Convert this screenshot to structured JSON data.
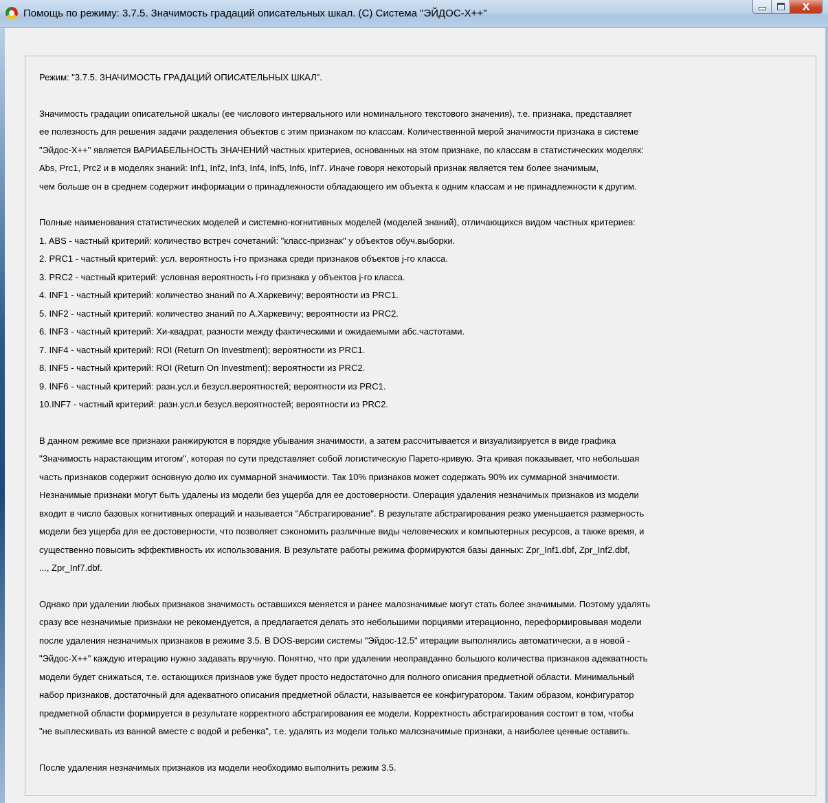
{
  "window": {
    "title": "Помощь по режиму: 3.7.5. Значимость градаций описательных шкал. (С) Система \"ЭЙДОС-Х++\"",
    "minimize_label": "",
    "close_label": "X"
  },
  "help": {
    "mode_title": "Режим: \"3.7.5. ЗНАЧИМОСТЬ ГРАДАЦИЙ ОПИСАТЕЛЬНЫХ ШКАЛ\".",
    "p1": "Значимость градации описательной шкалы (ее числового интервального или номинального текстового значения), т.е. признака, представляет\nее полезность для решения задачи разделения объектов с этим признаком по классам. Количественной мерой значимости признака в системе\n\"Эйдос-Х++\" является ВАРИАБЕЛЬНОСТЬ ЗНАЧЕНИЙ частных критериев, основанных на этом признаке, по классам в статистических моделях:\nAbs, Prc1, Prc2 и в моделях знаний: Inf1, Inf2, Inf3, Inf4, Inf5, Inf6, Inf7. Иначе говоря некоторый признак является тем более значимым,\nчем больше он в среднем содержит информации о принадлежности обладающего им объекта к одним классам и не принадлежности к другим.",
    "models_intro": "Полные наименования статистических моделей и системно-когнитивных моделей (моделей знаний), отличающихся видом частных критериев:",
    "models": [
      "1. ABS - частный критерий: количество встреч сочетаний: \"класс-признак\" у объектов обуч.выборки.",
      "2. PRC1 - частный критерий: усл. вероятность i-го признака среди признаков объектов j-го класса.",
      "3. PRC2 - частный критерий: условная вероятность i-го признака у объектов j-го класса.",
      "4. INF1 - частный критерий: количество знаний по А.Харкевичу; вероятности из PRC1.",
      "5. INF2 - частный критерий: количество знаний по А.Харкевичу; вероятности из PRC2.",
      "6. INF3 - частный критерий: Хи-квадрат, разности между фактическими и ожидаемыми абс.частотами.",
      "7. INF4 - частный критерий: ROI (Return On Investment); вероятности из PRC1.",
      "8. INF5 - частный критерий: ROI (Return On Investment); вероятности из PRC2.",
      "9. INF6 - частный критерий: разн.усл.и безусл.вероятностей; вероятности из PRC1.",
      "10.INF7 - частный критерий: разн.усл.и безусл.вероятностей; вероятности из PRC2."
    ],
    "p2": "В данном режиме все признаки ранжируются в порядке убывания значимости, а затем рассчитывается и визуализируется в виде графика\n\"Значимость нарастающим итогом\", которая по сути представляет собой логистическую Парето-кривую. Эта кривая показывает, что небольшая\nчасть признаков содержит основную долю их суммарной значимости. Так 10% признаков может содержать 90% их суммарной значимости.\nНезначимые признаки могут быть удалены из модели без ущерба для ее достоверности. Операция удаления незначимых признаков из модели\nвходит в число базовых когнитивных операций и называется \"Абстрагирование\". В результате абстрагирования резко уменьшается размерность\nмодели без ущерба для ее достоверности, что позволяет сэкономить различные виды человеческих и компьютерных ресурсов, а также время, и\nсущественно повысить эффективность их использования. В результате работы режима формируются базы данных: Zpr_Inf1.dbf, Zpr_Inf2.dbf,\n..., Zpr_Inf7.dbf.",
    "p3": "Однако при удалении любых признаков значимость оставшихся меняется и ранее малозначимые могут стать более значимыми. Поэтому удалять\nсразу все незначимые признаки не рекомендуется, а предлагается делать это небольшими порциями итерационно, переформировывая модели\nпосле удаления незначимых признаков в режиме 3.5. В DOS-версии системы \"Эйдос-12.5\" итерации выполнялись автоматически, а в новой -\n\"Эйдос-Х++\" каждую итерацию нужно задавать вручную. Понятно, что при удалении неоправданно большого количества признаков адекватность\nмодели будет снижаться, т.е. остающихся признаов уже будет просто недостаточно для полного описания предметной области. Минимальный\nнабор признаков, достаточный для адекватного описания предметной области, называется ее конфигуратором. Таким образом, конфигуратор\nпредметной области формируется в результате корректного абстрагирования ее модели. Корректность абстрагирования состоит в том, чтобы\n\"не выплескивать из ванной вместе с водой и ребенка\", т.е. удалять из модели только малозначимые признаки, а наиболее ценные оставить.",
    "p4": "После удаления незначимых признаков из модели необходимо выполнить режим 3.5."
  }
}
